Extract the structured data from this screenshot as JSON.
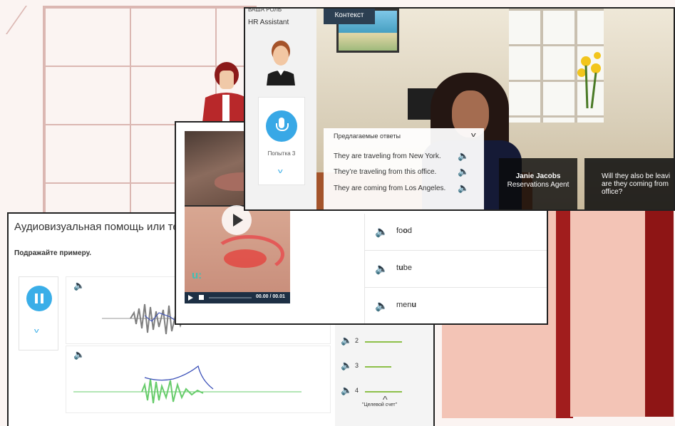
{
  "background": {
    "colors": {
      "wall_grid": "#dbb7b2",
      "box": "#f3c4b6",
      "box_dark": "#a11d1d"
    }
  },
  "window1": {
    "title": "Аудиовизуальная помощь или те",
    "instruction": "Подражайте примеру.",
    "pause_icon": "pause-icon",
    "scores": [
      {
        "label": "2",
        "fill": 0.85
      },
      {
        "label": "3",
        "fill": 0.6
      },
      {
        "label": "4",
        "fill": 0.85
      }
    ],
    "score_caption": "\"Целевой счет\"",
    "colors": {
      "accent": "#3aaee8",
      "score_line": "#8dc049",
      "waveform_native": "#7f7f7f",
      "waveform_user": "#67cc6b",
      "pitch": "#3a4fb8"
    }
  },
  "window2": {
    "video_time": "00.00 / 00.01",
    "logo": "u:",
    "words": [
      {
        "prefix": "fo",
        "bold": "o",
        "suffix": "d"
      },
      {
        "prefix": "t",
        "bold": "u",
        "suffix": "be"
      },
      {
        "prefix": "men",
        "bold": "u",
        "suffix": ""
      }
    ]
  },
  "window3": {
    "role_label": "ВАША РОЛЬ",
    "role_value": "HR Assistant",
    "attempt": "Попытка 3",
    "context_button": "Контекст",
    "suggestions_header": "Предлагаемые ответы",
    "suggestions": [
      "They are traveling from New York.",
      "They’re traveling from this office.",
      "They are coming from Los Angeles."
    ],
    "character_name": "Janie Jacobs",
    "character_role": "Reservations Agent",
    "question_lines": [
      "Will they also be leavi",
      "are they coming from",
      "office?"
    ]
  }
}
